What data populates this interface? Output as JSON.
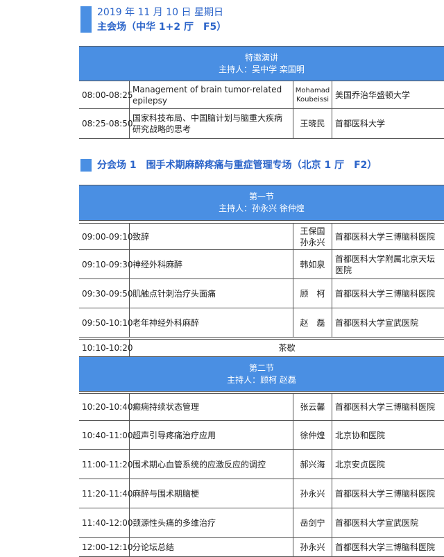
{
  "header": {
    "date": "2019 年 11 月 10 日 星期日",
    "main_venue": "主会场（中华 1+2 厅　F5）"
  },
  "plenary": {
    "title": "特邀演讲",
    "hosts": "主持人：吴中学 栾国明",
    "rows": [
      {
        "time": "08:00-08:25",
        "topic": "Management of brain tumor-related epilepsy",
        "speaker": "Mohamad Koubeissi",
        "institution": "美国乔治华盛顿大学"
      },
      {
        "time": "08:25-08:50",
        "topic": "国家科技布局、中国脑计划与脑重大疾病研究战略的思考",
        "speaker": "王晓民",
        "institution": "首都医科大学"
      }
    ]
  },
  "subvenue": {
    "title": "分会场 1　围手术期麻醉疼痛与重症管理专场（北京 1 厅　F2）",
    "section1": {
      "title": "第一节",
      "hosts": "主持人：孙永兴 徐仲煌",
      "rows": [
        {
          "time": "09:00-09:10",
          "topic": "致辞",
          "speaker": "王保国 孙永兴",
          "institution": "首都医科大学三博脑科医院"
        },
        {
          "time": "09:10-09:30",
          "topic": "神经外科麻醉",
          "speaker": "韩如泉",
          "institution": "首都医科大学附属北京天坛医院"
        },
        {
          "time": "09:30-09:50",
          "topic": "肌触点针刺治疗头面痛",
          "speaker": "顾　柯",
          "institution": "首都医科大学三博脑科医院"
        },
        {
          "time": "09:50-10:10",
          "topic": "老年神经外科麻醉",
          "speaker": "赵　磊",
          "institution": "首都医科大学宣武医院"
        }
      ],
      "break_time": "10:10-10:20",
      "break_label": "茶歇"
    },
    "section2": {
      "title": "第二节",
      "hosts": "主持人：顾柯 赵磊",
      "rows": [
        {
          "time": "10:20-10:40",
          "topic": "癫痫持续状态管理",
          "speaker": "张云馨",
          "institution": "首都医科大学三博脑科医院"
        },
        {
          "time": "10:40-11:00",
          "topic": "超声引导疼痛治疗应用",
          "speaker": "徐仲煌",
          "institution": "北京协和医院"
        },
        {
          "time": "11:00-11:20",
          "topic": "围术期心血管系统的应激反应的调控",
          "speaker": "郝兴海",
          "institution": "北京安贞医院"
        },
        {
          "time": "11:20-11:40",
          "topic": "麻醉与围术期脑梗",
          "speaker": "孙永兴",
          "institution": "首都医科大学三博脑科医院"
        },
        {
          "time": "11:40-12:00",
          "topic": "颈源性头痛的多维治疗",
          "speaker": "岳剑宁",
          "institution": "首都医科大学宣武医院"
        },
        {
          "time": "12:00-12:10",
          "topic": "分论坛总结",
          "speaker": "孙永兴",
          "institution": "首都医科大学三博脑科医院"
        }
      ]
    }
  }
}
